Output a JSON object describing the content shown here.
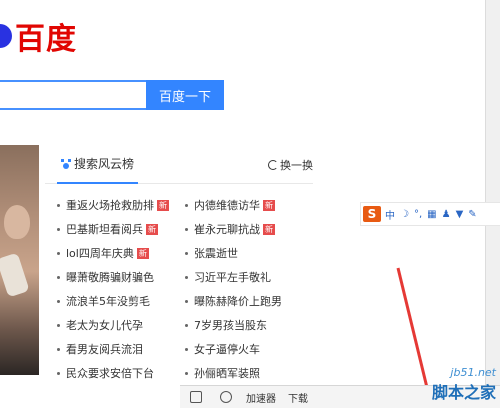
{
  "logo": {
    "text": "百度"
  },
  "search": {
    "button_label": "百度一下"
  },
  "hot": {
    "tab_label": "搜索风云榜",
    "refresh_label": "换一换",
    "new_badge": "新",
    "left": [
      {
        "text": "重返火场抢救肋排",
        "new": true
      },
      {
        "text": "巴基斯坦看阅兵",
        "new": true
      },
      {
        "text": "lol四周年庆典",
        "new": true
      },
      {
        "text": "曝萧敬腾骗财骗色",
        "new": false
      },
      {
        "text": "流浪羊5年没剪毛",
        "new": false
      },
      {
        "text": "老太为女儿代孕",
        "new": false
      },
      {
        "text": "看男友阅兵流泪",
        "new": false
      },
      {
        "text": "民众要求安倍下台",
        "new": false
      }
    ],
    "right": [
      {
        "text": "内德维德访华",
        "new": true
      },
      {
        "text": "崔永元聊抗战",
        "new": true
      },
      {
        "text": "张震逝世",
        "new": false
      },
      {
        "text": "习近平左手敬礼",
        "new": false
      },
      {
        "text": "曝陈赫降价上跑男",
        "new": false
      },
      {
        "text": "7岁男孩当股东",
        "new": false
      },
      {
        "text": "女子逼停火车",
        "new": false
      },
      {
        "text": "孙俪晒军装照",
        "new": false
      }
    ]
  },
  "ime": {
    "logo": "S",
    "mode": "中",
    "moon": "☽",
    "punct": "°,"
  },
  "status_bar": {
    "accelerator": "加速器",
    "download": "下载"
  },
  "watermark": {
    "url": "jb51.net",
    "name": "脚本之家"
  },
  "colors": {
    "baidu_red": "#e10602",
    "baidu_blue": "#2932e1",
    "button_blue": "#3385ff",
    "badge_red": "#e64c4c",
    "arrow_red": "#e53935"
  }
}
